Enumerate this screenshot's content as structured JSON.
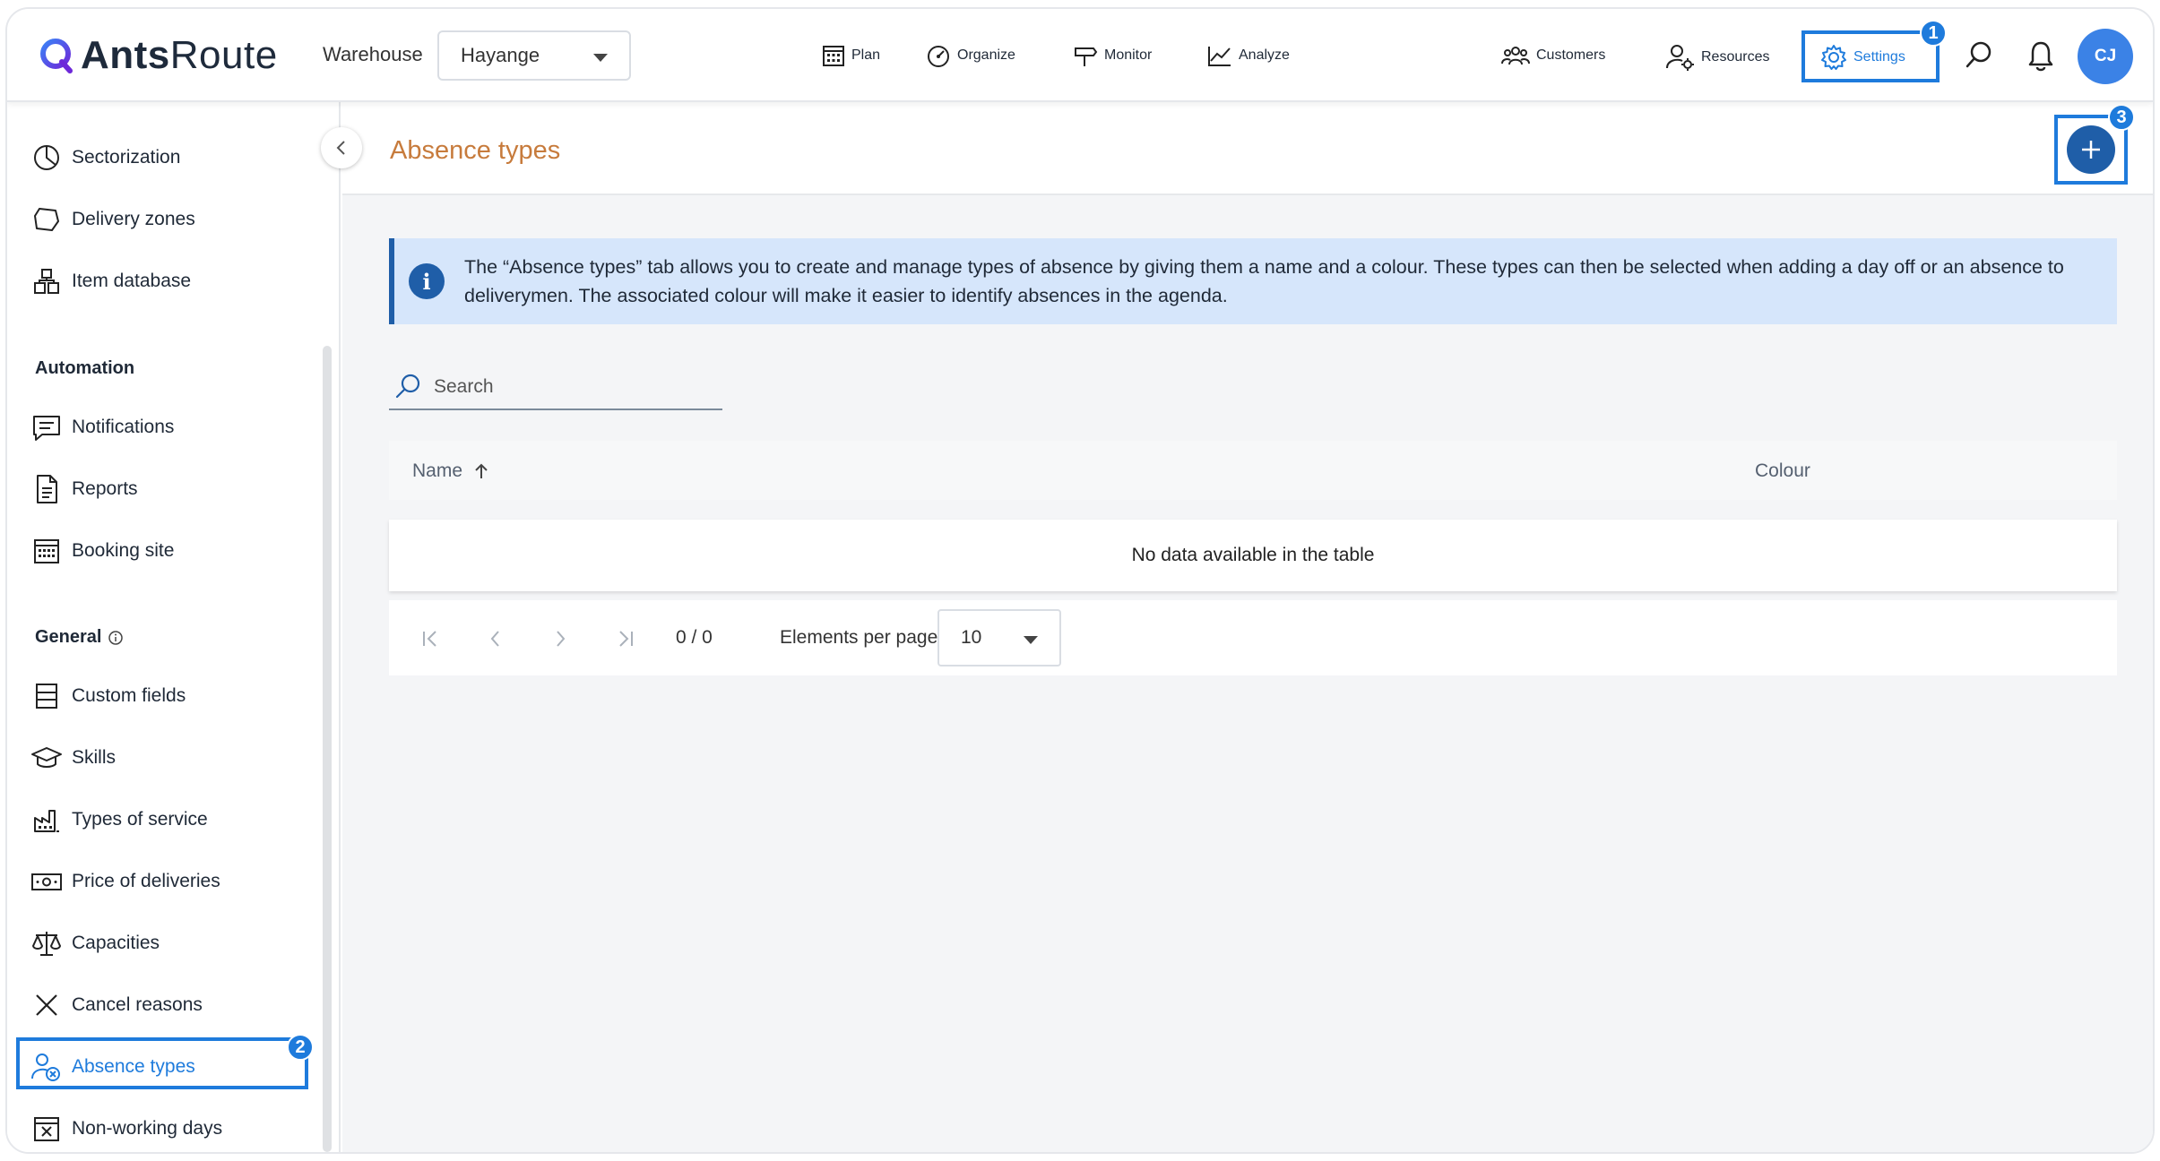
{
  "app": {
    "logo_bold": "Ants",
    "logo_light": "Route"
  },
  "header": {
    "warehouse_label": "Warehouse",
    "warehouse_value": "Hayange",
    "nav": [
      "Plan",
      "Organize",
      "Monitor",
      "Analyze"
    ],
    "customers_label": "Customers",
    "resources_label": "Resources",
    "settings_label": "Settings",
    "avatar_initials": "CJ"
  },
  "annotations": {
    "badge1": "1",
    "badge2": "2",
    "badge3": "3"
  },
  "sidebar": {
    "items_top": [
      {
        "label": "Sectorization",
        "icon": "pie-chart-icon"
      },
      {
        "label": "Delivery zones",
        "icon": "polygon-icon"
      },
      {
        "label": "Item database",
        "icon": "boxes-icon"
      }
    ],
    "automation_title": "Automation",
    "items_automation": [
      {
        "label": "Notifications",
        "icon": "message-icon"
      },
      {
        "label": "Reports",
        "icon": "document-icon"
      },
      {
        "label": "Booking site",
        "icon": "calendar-icon"
      }
    ],
    "general_title": "General",
    "items_general": [
      {
        "label": "Custom fields",
        "icon": "fields-icon"
      },
      {
        "label": "Skills",
        "icon": "graduation-cap-icon"
      },
      {
        "label": "Types of service",
        "icon": "factory-icon"
      },
      {
        "label": "Price of deliveries",
        "icon": "banknote-icon"
      },
      {
        "label": "Capacities",
        "icon": "scale-icon"
      },
      {
        "label": "Cancel reasons",
        "icon": "x-icon"
      },
      {
        "label": "Absence types",
        "icon": "user-x-icon",
        "active": true
      },
      {
        "label": "Non-working days",
        "icon": "calendar-x-icon"
      }
    ]
  },
  "main": {
    "title": "Absence types",
    "info_text": "The “Absence types” tab allows you to create and manage types of absence by giving them a name and a colour. These types can then be selected when adding a day off or an absence to deliverymen. The associated colour will make it easier to identify absences in the agenda.",
    "search_placeholder": "Search",
    "table": {
      "columns": [
        "Name",
        "Colour"
      ],
      "empty_message": "No data available in the table"
    },
    "pager": {
      "count": "0 / 0",
      "per_page_label": "Elements per page",
      "per_page_value": "10"
    }
  },
  "colors": {
    "accent": "#1f5ea8",
    "highlight": "#1e7bdc",
    "title": "#c77b3c",
    "info_bg": "#d6e6fb"
  }
}
